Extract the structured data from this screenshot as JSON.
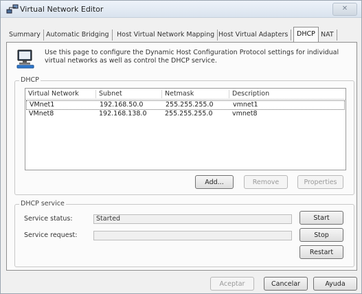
{
  "window": {
    "title": "Virtual Network Editor",
    "close_glyph": "✕"
  },
  "tabs": [
    {
      "label": "Summary"
    },
    {
      "label": "Automatic Bridging"
    },
    {
      "label": "Host Virtual Network Mapping"
    },
    {
      "label": "Host Virtual Adapters"
    },
    {
      "label": "DHCP",
      "active": true
    },
    {
      "label": "NAT"
    }
  ],
  "info": {
    "icon": "computer-network-icon",
    "text": "Use this page to configure the Dynamic Host Configuration Protocol settings for individual virtual networks as well as control the DHCP service."
  },
  "dhcp_group": {
    "legend": "DHCP",
    "columns": [
      "Virtual Network",
      "Subnet",
      "Netmask",
      "Description"
    ],
    "rows": [
      {
        "network": "VMnet1",
        "subnet": "192.168.50.0",
        "netmask": "255.255.255.0",
        "description": "vmnet1",
        "selected": true
      },
      {
        "network": "VMnet8",
        "subnet": "192.168.138.0",
        "netmask": "255.255.255.0",
        "description": "vmnet8"
      }
    ],
    "add_label": "Add...",
    "remove_label": "Remove",
    "properties_label": "Properties"
  },
  "service_group": {
    "legend": "DHCP service",
    "status_label": "Service status:",
    "status_value": "Started",
    "request_label": "Service request:",
    "request_value": "",
    "start_label": "Start",
    "stop_label": "Stop",
    "restart_label": "Restart"
  },
  "footer": {
    "accept_label": "Aceptar",
    "cancel_label": "Cancelar",
    "help_label": "Ayuda"
  }
}
